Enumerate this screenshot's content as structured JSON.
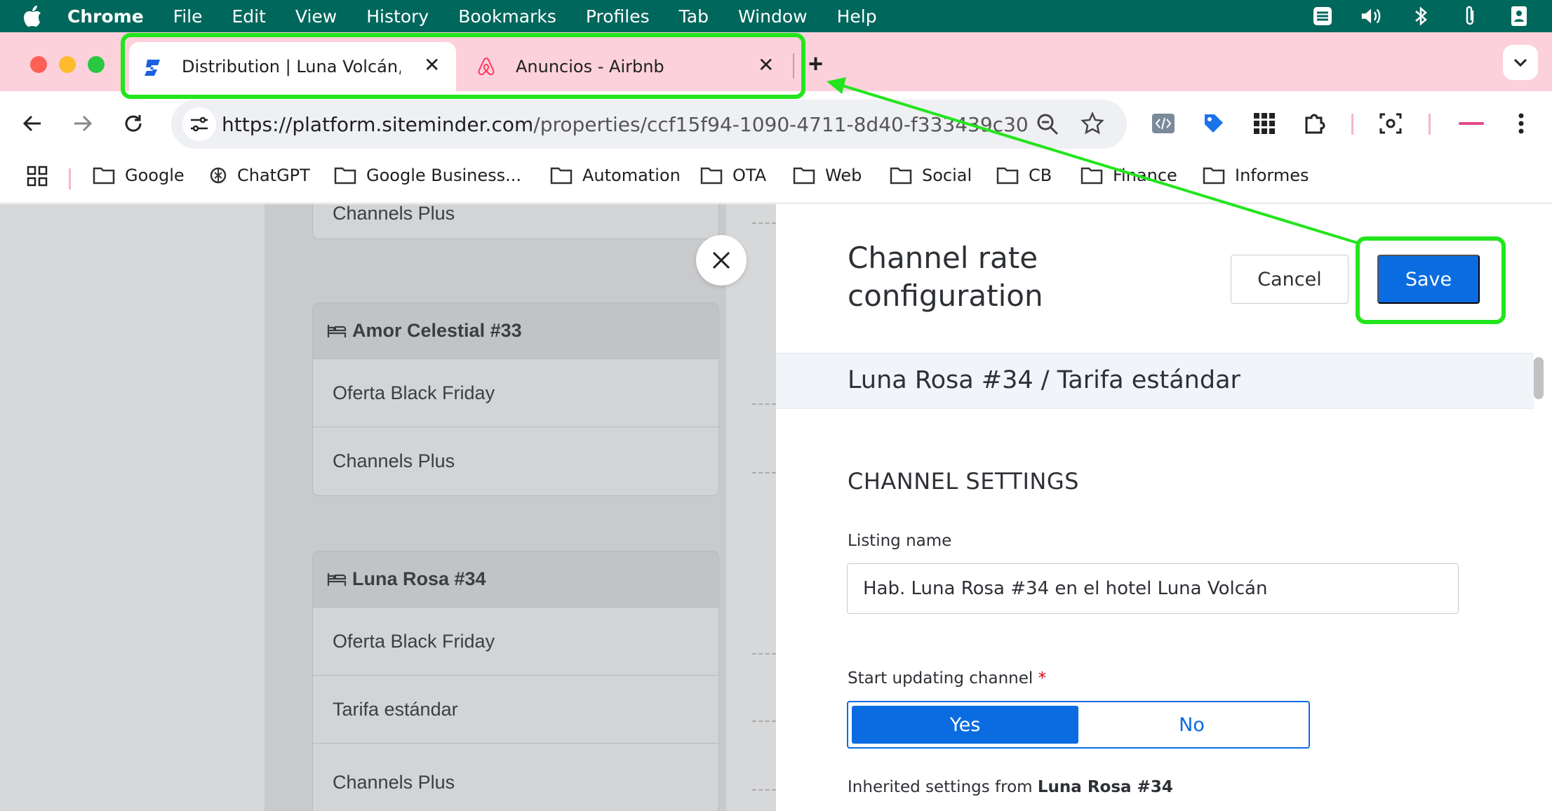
{
  "menubar": {
    "items": [
      "Chrome",
      "File",
      "Edit",
      "View",
      "History",
      "Bookmarks",
      "Profiles",
      "Tab",
      "Window",
      "Help"
    ]
  },
  "tabs": [
    {
      "title": "Distribution | Luna Volcán, Adults Only",
      "icon": "siteminder-icon",
      "active": true
    },
    {
      "title": "Anuncios - Airbnb",
      "icon": "airbnb-icon",
      "active": false
    }
  ],
  "omnibox": {
    "url_domain": "https://platform.siteminder.com",
    "url_path": "/properties/ccf15f94-1090-4711-8d40-f333439c30..."
  },
  "bookmarks": [
    "Google",
    "ChatGPT",
    "Google Business...",
    "Automation",
    "OTA",
    "Web",
    "Social",
    "CB",
    "Finance",
    "Informes"
  ],
  "rate_plans": {
    "top_partial": "Channels Plus",
    "rooms": [
      {
        "name": "Amor Celestial #33",
        "rates": [
          "Oferta Black Friday",
          "Channels Plus"
        ]
      },
      {
        "name": "Luna Rosa #34",
        "rates": [
          "Oferta Black Friday",
          "Tarifa estándar",
          "Channels Plus"
        ]
      }
    ]
  },
  "drawer": {
    "title": "Channel rate configuration",
    "cancel_label": "Cancel",
    "save_label": "Save",
    "subheading": "Luna Rosa #34 / Tarifa estándar",
    "section_title": "CHANNEL SETTINGS",
    "listing_name_label": "Listing name",
    "listing_name_value": "Hab. Luna Rosa #34 en el hotel Luna Volcán",
    "start_updating_label": "Start updating channel",
    "required_mark": "*",
    "toggle": {
      "yes": "Yes",
      "no": "No",
      "selected": "Yes"
    },
    "inherited_prefix": "Inherited settings from",
    "inherited_from": "Luna Rosa #34"
  },
  "colors": {
    "menubar": "#00675c",
    "tabstrip": "#fcd1dc",
    "primary": "#0a6ce0",
    "annotation": "#22e51c"
  }
}
